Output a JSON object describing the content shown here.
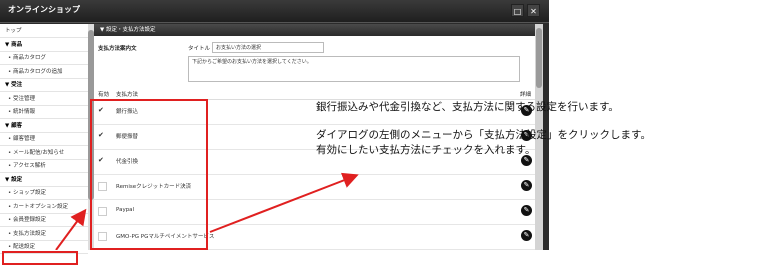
{
  "window": {
    "title": "オンラインショップ",
    "btn_restore": "□",
    "btn_close": "✕"
  },
  "sidebar": {
    "items": [
      {
        "label": "トップ",
        "kind": "item"
      },
      {
        "label": "▼ 商品",
        "kind": "sect"
      },
      {
        "label": "• 商品カタログ",
        "kind": "sub"
      },
      {
        "label": "• 商品カタログの追加",
        "kind": "sub"
      },
      {
        "label": "▼ 受注",
        "kind": "sect"
      },
      {
        "label": "• 受注管理",
        "kind": "sub"
      },
      {
        "label": "• 統計情報",
        "kind": "sub"
      },
      {
        "label": "▼ 顧客",
        "kind": "sect"
      },
      {
        "label": "• 顧客管理",
        "kind": "sub"
      },
      {
        "label": "• メール配信/お知らせ",
        "kind": "sub"
      },
      {
        "label": "• アクセス解析",
        "kind": "sub"
      },
      {
        "label": "▼ 設定",
        "kind": "sect"
      },
      {
        "label": "• ショップ設定",
        "kind": "sub"
      },
      {
        "label": "• カートオプション設定",
        "kind": "sub"
      },
      {
        "label": "• 会員登録設定",
        "kind": "sub"
      },
      {
        "label": "• 支払方法設定",
        "kind": "sub"
      },
      {
        "label": "• 配送設定",
        "kind": "sub"
      }
    ]
  },
  "content": {
    "header": "▼ 設定・支払方法設定",
    "section_label": "支払方法案内文",
    "title_label": "タイトル",
    "title_value": "お支払い方法の選択",
    "desc_value": "下記からご希望のお支払い方法を選択してください。",
    "col_enabled": "有効",
    "col_method": "支払方法",
    "col_edit": "詳細",
    "methods": [
      {
        "name": "銀行振込",
        "checked": true
      },
      {
        "name": "郵便振替",
        "checked": true
      },
      {
        "name": "代金引換",
        "checked": true
      },
      {
        "name": "Remiseクレジットカード決済",
        "checked": false
      },
      {
        "name": "Paypal",
        "checked": false
      },
      {
        "name": "GMO-PG PGマルチペイメントサービス",
        "checked": false
      }
    ],
    "edit_glyph": "✎"
  },
  "annotation": {
    "line1": "銀行振込みや代金引換など、支払方法に関する設定を行います。",
    "line2": "ダイアログの左側のメニューから「支払方法設定」をクリックします。",
    "line3": "有効にしたい支払方法にチェックを入れます。",
    "color": "#e02020"
  }
}
